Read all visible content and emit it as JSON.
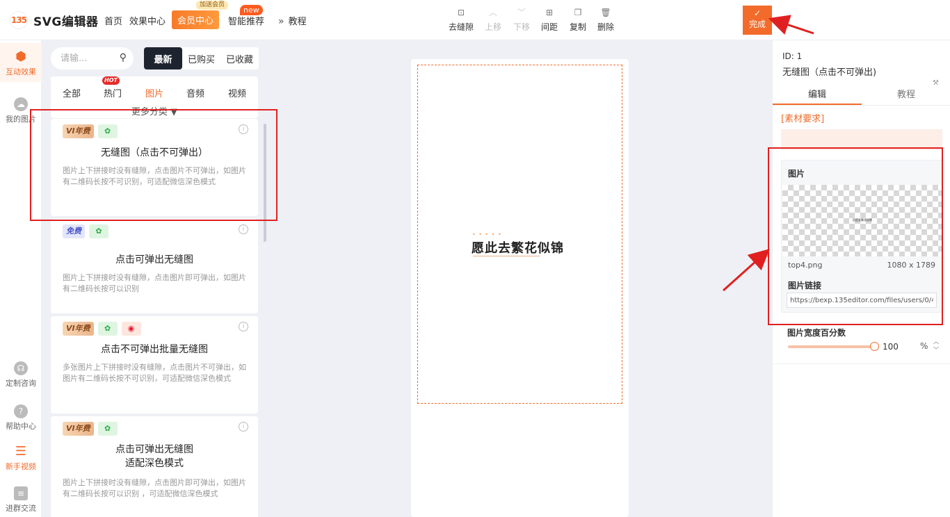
{
  "header": {
    "logo_mark": "135",
    "logo_text": "SVG编辑器",
    "nav": [
      "首页",
      "效果中心"
    ],
    "vip_label": "会员中心",
    "vip_tag": "加送会员",
    "smart_label": "智能推荐",
    "new_tag": "new",
    "tutorial_label": "教程"
  },
  "toolbar": [
    {
      "label": "去缝隙",
      "icon": "seam-icon",
      "enabled": true
    },
    {
      "label": "上移",
      "icon": "chevron-up-icon",
      "enabled": false
    },
    {
      "label": "下移",
      "icon": "chevron-down-icon",
      "enabled": false
    },
    {
      "label": "间距",
      "icon": "spacing-icon",
      "enabled": true
    },
    {
      "label": "复制",
      "icon": "copy-icon",
      "enabled": true
    },
    {
      "label": "删除",
      "icon": "trash-icon",
      "enabled": true
    }
  ],
  "done_label": "完成",
  "rail": [
    {
      "label": "互动效果",
      "active": true
    },
    {
      "label": "我的图片",
      "active": false
    },
    {
      "label": "定制咨询",
      "active": false
    },
    {
      "label": "帮助中心",
      "active": false
    },
    {
      "label": "新手视频",
      "active": false
    },
    {
      "label": "进群交流",
      "active": false
    }
  ],
  "panel": {
    "search_placeholder": "请输...",
    "filters": [
      "最新",
      "已购买",
      "已收藏"
    ],
    "categories": [
      "全部",
      "热门",
      "图片",
      "音频",
      "视频"
    ],
    "active_category": "图片",
    "hot_tag": "HOT",
    "more_categories": "更多分类",
    "cards": [
      {
        "badges": [
          {
            "type": "vip",
            "text": "VI年费"
          },
          {
            "type": "wx",
            "text": "微信"
          }
        ],
        "title": "无缝图（点击不可弹出）",
        "desc": "图片上下拼接时没有缝隙，点击图片不可弹出，如图片有二维码长按不可识别，可适配微信深色模式"
      },
      {
        "badges": [
          {
            "type": "free",
            "text": "免费"
          },
          {
            "type": "wx",
            "text": "微信"
          }
        ],
        "title": "点击可弹出无缝图",
        "desc": "图片上下拼接时没有缝隙，点击图片即可弹出，如图片有二维码长按可以识别"
      },
      {
        "badges": [
          {
            "type": "vip",
            "text": "VI年费"
          },
          {
            "type": "wx",
            "text": "微信"
          },
          {
            "type": "wb",
            "text": "微博"
          }
        ],
        "title": "点击不可弹出批量无缝图",
        "desc": "多张图片上下拼接时没有缝隙，点击图片不可弹出，如图片有二维码长按不可识别，可适配微信深色模式"
      },
      {
        "badges": [
          {
            "type": "vip",
            "text": "VI年费"
          },
          {
            "type": "wx",
            "text": "微信"
          }
        ],
        "title": "点击可弹出无缝图\n适配深色模式",
        "desc": "图片上下拼接时没有缝隙，点击图片即可弹出，如图片有二维码长按可以识别 ，可适配微信深色模式"
      }
    ]
  },
  "canvas": {
    "text": "愿此去繁花似锦",
    "dots": "• • • • •"
  },
  "right": {
    "id_label": "ID: 1",
    "name": "无缝图（点击不可弹出)",
    "tabs": [
      "编辑",
      "教程"
    ],
    "requirements_label": "[素材要求]",
    "image_label": "图片",
    "preview_text": "愿此去繁花似锦",
    "file_name": "top4.png",
    "dimensions": "1080 x 1789",
    "link_label": "图片链接",
    "link_value": "https://bexp.135editor.com/files/users/0/485/20",
    "width_label": "图片宽度百分数",
    "width_value": "100",
    "width_unit": "%"
  },
  "colors": {
    "accent": "#f26b2a",
    "annotation": "#e02020"
  }
}
